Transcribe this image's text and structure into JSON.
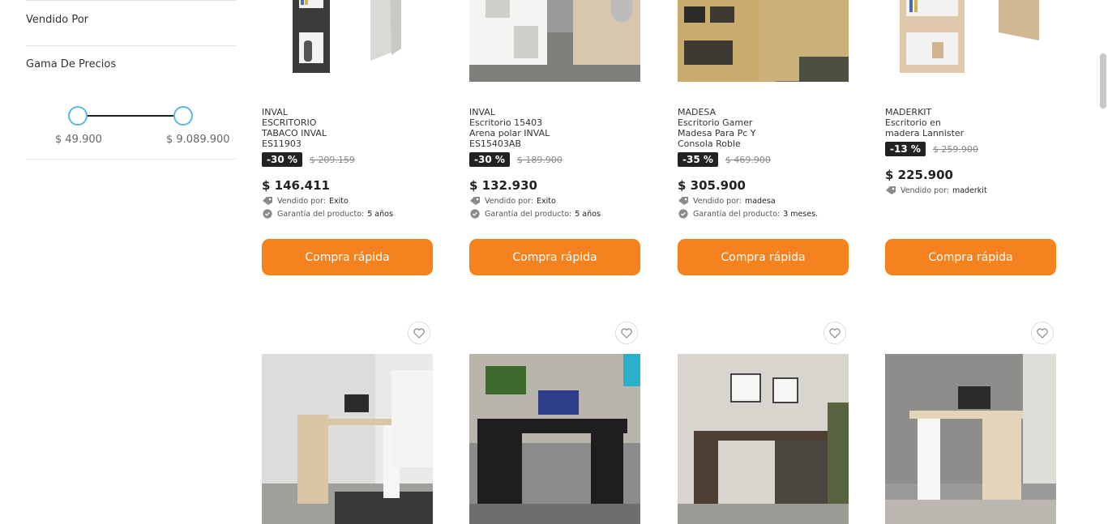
{
  "sidebar": {
    "vendido_por_label": "Vendido Por",
    "price_range_label": "Gama De Precios",
    "price_min": "$ 49.900",
    "price_max": "$ 9.089.900"
  },
  "products_row1": [
    {
      "brand": "INVAL",
      "name_lines": [
        "ESCRITORIO",
        "TABACO INVAL",
        "ES11903"
      ],
      "discount": "-30 %",
      "old_price": "$ 209.159",
      "price": "$ 146.411",
      "seller_label": "Vendido por:",
      "seller": "Exito",
      "warranty_label": "Garantía del producto:",
      "warranty": "5 años",
      "button": "Compra rápida"
    },
    {
      "brand": "INVAL",
      "name_lines": [
        "Escritorio 15403",
        "Arena polar INVAL",
        "ES15403AB"
      ],
      "discount": "-30 %",
      "old_price": "$ 189.900",
      "price": "$ 132.930",
      "seller_label": "Vendido por:",
      "seller": "Exito",
      "warranty_label": "Garantía del producto:",
      "warranty": "5 años",
      "button": "Compra rápida"
    },
    {
      "brand": "MADESA",
      "name_lines": [
        "Escritorio Gamer",
        "Madesa Para Pc Y",
        "Consola Roble"
      ],
      "discount": "-35 %",
      "old_price": "$ 469.900",
      "price": "$ 305.900",
      "seller_label": "Vendido por:",
      "seller": "madesa",
      "warranty_label": "Garantía del producto:",
      "warranty": "3 meses.",
      "button": "Compra rápida"
    },
    {
      "brand": "MADERKIT",
      "name_lines": [
        "Escritorio en",
        "madera Lannister"
      ],
      "discount": "-13 %",
      "old_price": "$ 259.900",
      "price": "$ 225.900",
      "seller_label": "Vendido por:",
      "seller": "maderkit",
      "button": "Compra rápida"
    }
  ],
  "icons": {
    "favorite": "heart-icon",
    "seller": "tag-icon",
    "warranty": "badge-check-icon"
  },
  "colors": {
    "accent": "#f5821f",
    "badge": "#222222",
    "slider": "#5bb7dd"
  }
}
